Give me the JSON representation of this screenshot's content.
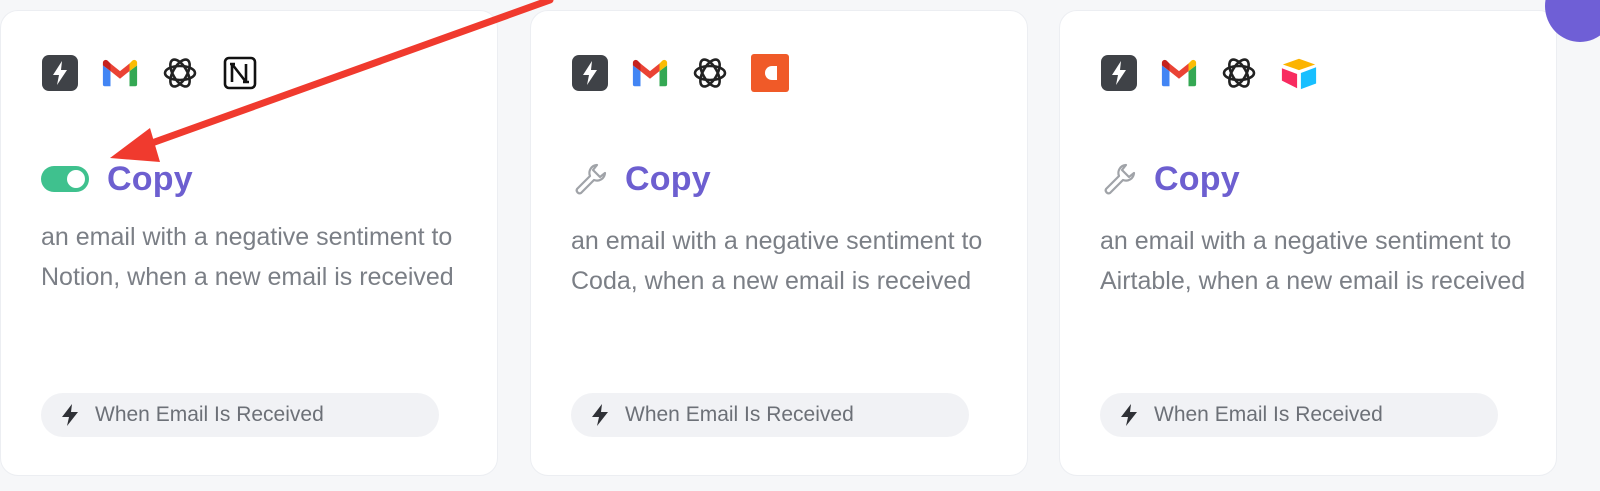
{
  "colors": {
    "accent": "#6d5fd0",
    "toggle_on": "#3fc18e",
    "annotation_arrow": "#f03a2e",
    "gmail_red": "#ea4335",
    "coda": "#f05a28"
  },
  "annotation": {
    "type": "red-arrow",
    "points_to": "card-1 toggle-switch"
  },
  "cards": [
    {
      "apps": [
        "zap-icon",
        "gmail-icon",
        "openai-icon",
        "notion-icon"
      ],
      "status_control": "toggle-on",
      "title": "Copy",
      "description": "an email with a negative sentiment to Notion, when a new email is received",
      "trigger": "When Email Is Received"
    },
    {
      "apps": [
        "zap-icon",
        "gmail-icon",
        "openai-icon",
        "coda-icon"
      ],
      "status_control": "wrench-icon",
      "title": "Copy",
      "description": "an email with a negative sentiment to Coda, when a new email is received",
      "trigger": "When Email Is Received"
    },
    {
      "apps": [
        "zap-icon",
        "gmail-icon",
        "openai-icon",
        "airtable-icon"
      ],
      "status_control": "wrench-icon",
      "title": "Copy",
      "description": "an email with a negative sentiment to Airtable, when a new email is received",
      "trigger": "When Email Is Received"
    }
  ]
}
